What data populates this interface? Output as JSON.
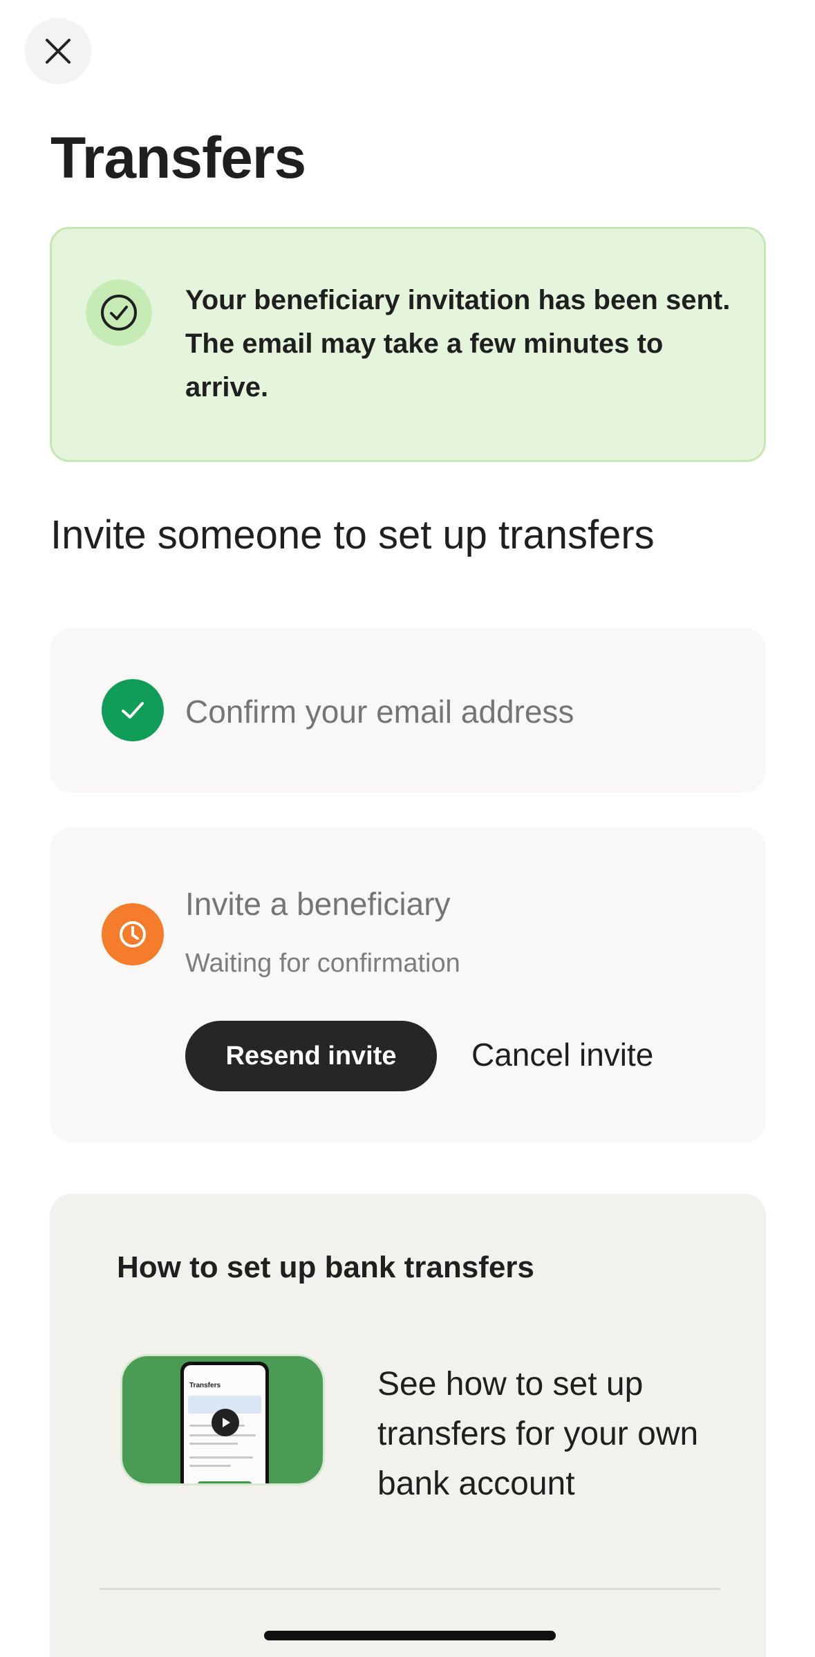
{
  "header": {
    "close_icon": "close-icon",
    "title": "Transfers"
  },
  "banner": {
    "icon": "check-circle-icon",
    "message": "Your beneficiary invitation has been sent. The email may take a few minutes to arrive.",
    "colors": {
      "background": "#e5f5dc",
      "border": "#c4e8b4"
    }
  },
  "invite_section": {
    "heading": "Invite someone to set up transfers",
    "steps": [
      {
        "label": "Confirm your email address",
        "status": "complete",
        "icon": "check-icon",
        "color": "#0f9d58"
      },
      {
        "label": "Invite a beneficiary",
        "status": "pending",
        "sub": "Waiting for confirmation",
        "icon": "clock-icon",
        "color": "#f57c2a"
      }
    ],
    "resend_label": "Resend invite",
    "cancel_label": "Cancel invite"
  },
  "help": {
    "title": "How to set up bank transfers",
    "video_icon": "play-icon",
    "description": "See how to set up transfers for your own bank account",
    "thumbnail_title": "Transfers"
  }
}
